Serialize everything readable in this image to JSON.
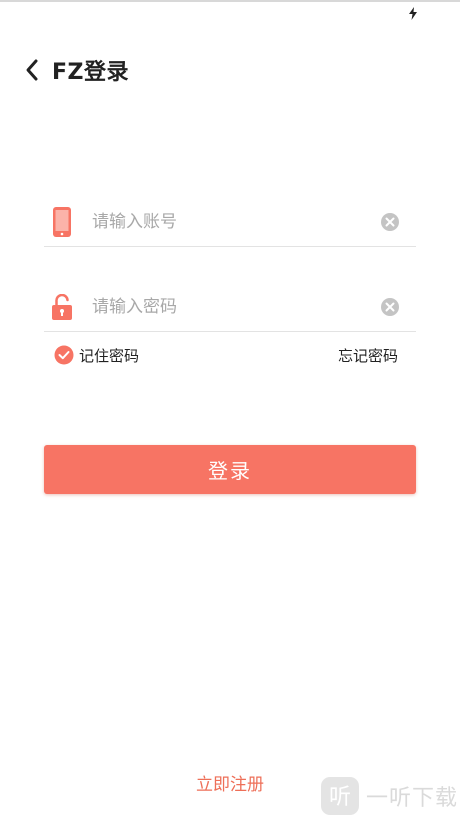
{
  "header": {
    "title": "FZ登录"
  },
  "form": {
    "account": {
      "placeholder": "请输入账号",
      "value": ""
    },
    "password": {
      "placeholder": "请输入密码",
      "value": ""
    },
    "remember_label": "记住密码",
    "remember_checked": true,
    "forgot_label": "忘记密码",
    "login_label": "登录",
    "register_label": "立即注册"
  },
  "watermark": {
    "logo_text": "听",
    "text": "一听下载"
  },
  "icons": {
    "back": "chevron-left-icon",
    "phone": "phone-icon",
    "lock": "unlock-icon",
    "clear": "clear-icon",
    "check": "check-circle-icon",
    "bolt": "bolt-icon"
  },
  "colors": {
    "accent": "#f77464",
    "register_text": "#ee6f58",
    "clear_icon": "#c4c4c4",
    "title": "#222222"
  }
}
